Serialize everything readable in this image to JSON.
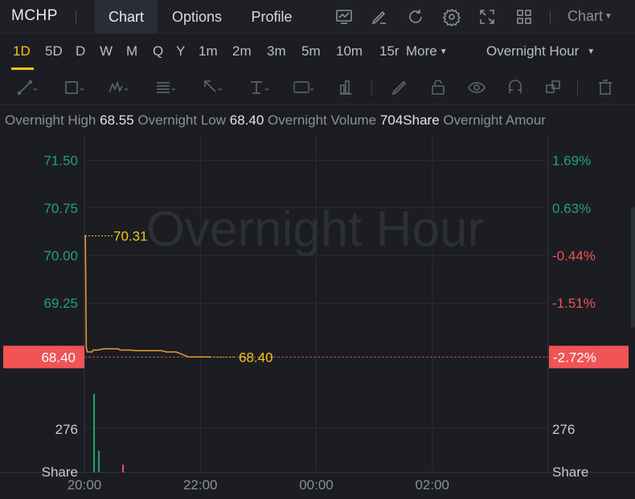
{
  "header": {
    "ticker": "MCHP",
    "tabs": [
      {
        "label": "Chart",
        "active": true
      },
      {
        "label": "Options",
        "active": false
      },
      {
        "label": "Profile",
        "active": false
      }
    ],
    "icons": [
      "chart-type-icon",
      "draw-pen-icon",
      "refresh-icon",
      "settings-gear-icon",
      "fullscreen-icon",
      "grid-layout-icon"
    ],
    "chart_dropdown": "Chart"
  },
  "periods": {
    "items": [
      "1D",
      "5D",
      "D",
      "W",
      "M",
      "Q",
      "Y",
      "1m",
      "2m",
      "3m",
      "5m",
      "10m",
      "15r"
    ],
    "active": "1D",
    "more_label": "More",
    "session_label": "Overnight Hour"
  },
  "drawing_tools": [
    "trend-line-icon",
    "rectangle-icon",
    "pattern-icon",
    "fibonacci-icon",
    "arrow-icon",
    "text-marker-icon",
    "text-label-icon",
    "measure-icon",
    "pencil-icon",
    "lock-icon",
    "eye-icon",
    "magnet-icon",
    "layers-icon",
    "trash-icon"
  ],
  "info": {
    "high_label": "Overnight High",
    "high_value": "68.55",
    "low_label": "Overnight Low",
    "low_value": "68.40",
    "volume_label": "Overnight Volume",
    "volume_value": "704Share",
    "amount_label": "Overnight Amour"
  },
  "colors": {
    "up": "#26a269",
    "down": "#f05454",
    "accent": "#f5c518",
    "line": "#e6a035",
    "background": "#1b1d22"
  },
  "chart_data": {
    "type": "line",
    "watermark": "Overnight Hour",
    "ylim": [
      68.1,
      71.9
    ],
    "y_ticks_left": [
      "71.50",
      "70.75",
      "70.00",
      "69.25"
    ],
    "y_ticks_left_values": [
      71.5,
      70.75,
      70.0,
      69.25
    ],
    "y_ticks_right": [
      "1.69%",
      "0.63%",
      "-0.44%",
      "-1.51%"
    ],
    "current_price": "68.40",
    "current_pct": "-2.72%",
    "max_label": "70.31",
    "last_label": "68.40",
    "x_ticks": [
      "20:00",
      "22:00",
      "00:00",
      "02:00"
    ],
    "x_minutes_ticks": [
      0,
      120,
      240,
      360
    ],
    "xlim_minutes": [
      0,
      480
    ],
    "series": [
      {
        "points_minutes": [
          0,
          1,
          2,
          3,
          8,
          9,
          14,
          20,
          35,
          37,
          48,
          52,
          80,
          85,
          95,
          108,
          130
        ],
        "values": [
          70.31,
          70.31,
          68.55,
          68.48,
          68.48,
          68.51,
          68.51,
          68.53,
          68.53,
          68.51,
          68.51,
          68.5,
          68.5,
          68.48,
          68.48,
          68.4,
          68.4
        ]
      }
    ],
    "volume": {
      "label": "276",
      "unit": "Share",
      "max": 400,
      "bars": [
        {
          "minute": 10,
          "value": 400,
          "dir": "up"
        },
        {
          "minute": 15,
          "value": 110,
          "dir": "up"
        },
        {
          "minute": 40,
          "value": 40,
          "dir": "down"
        }
      ]
    }
  }
}
